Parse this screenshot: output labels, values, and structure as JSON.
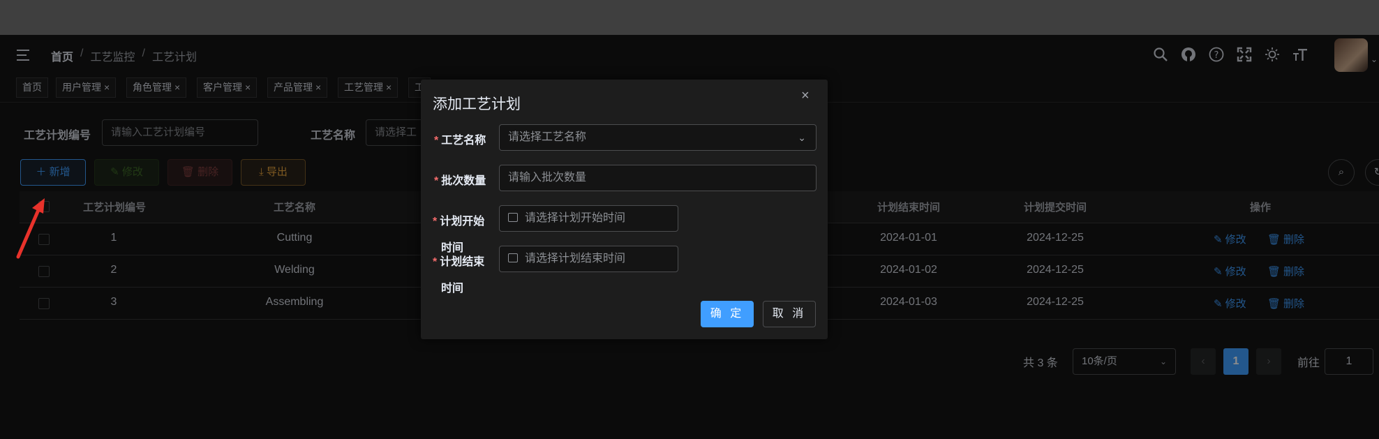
{
  "breadcrumb": [
    "首页",
    "工艺监控",
    "工艺计划"
  ],
  "tags": [
    {
      "label": "首页",
      "closable": false
    },
    {
      "label": "用户管理",
      "closable": true
    },
    {
      "label": "角色管理",
      "closable": true
    },
    {
      "label": "客户管理",
      "closable": true
    },
    {
      "label": "产品管理",
      "closable": true
    },
    {
      "label": "工艺管理",
      "closable": true
    },
    {
      "label": "工",
      "closable": false
    }
  ],
  "tag_close": "×",
  "search": {
    "plan_no_label": "工艺计划编号",
    "plan_no_placeholder": "请输入工艺计划编号",
    "craft_name_label": "工艺名称",
    "craft_name_placeholder": "请选择工"
  },
  "toolbar": {
    "add": "新增",
    "edit": "修改",
    "delete": "删除",
    "export": "导出"
  },
  "table": {
    "headers": {
      "plan_no": "工艺计划编号",
      "craft_name": "工艺名称",
      "plan_end": "计划结束时间",
      "plan_submit": "计划提交时间",
      "ops": "操作"
    },
    "rows": [
      {
        "no": "1",
        "name": "Cutting",
        "end": "2024-01-01",
        "submit": "2024-12-25"
      },
      {
        "no": "2",
        "name": "Welding",
        "end": "2024-01-02",
        "submit": "2024-12-25"
      },
      {
        "no": "3",
        "name": "Assembling",
        "end": "2024-01-03",
        "submit": "2024-12-25"
      }
    ],
    "row_edit": "修改",
    "row_delete": "删除"
  },
  "pagination": {
    "total": "共 3 条",
    "page_size": "10条/页",
    "current": "1",
    "goto_label": "前往",
    "goto_value": "1"
  },
  "dialog": {
    "title": "添加工艺计划",
    "close": "×",
    "fields": {
      "craft_name_label": "工艺名称",
      "craft_name_placeholder": "请选择工艺名称",
      "batch_qty_label": "批次数量",
      "batch_qty_placeholder": "请输入批次数量",
      "plan_start_label_1": "计划开始",
      "plan_start_label_2": "时间",
      "plan_start_placeholder": "请选择计划开始时间",
      "plan_end_label_1": "计划结束",
      "plan_end_label_2": "时间",
      "plan_end_placeholder": "请选择计划结束时间"
    },
    "required_mark": "*",
    "confirm": "确 定",
    "cancel": "取 消"
  },
  "icons": [
    "menu-icon",
    "search-icon",
    "github-icon",
    "help-icon",
    "fullscreen-icon",
    "theme-sun-icon",
    "font-size-icon"
  ],
  "colors": {
    "primary": "#409eff",
    "danger": "#f56c6c",
    "warning": "#e6a23c",
    "annotation_arrow": "#e8322b"
  }
}
